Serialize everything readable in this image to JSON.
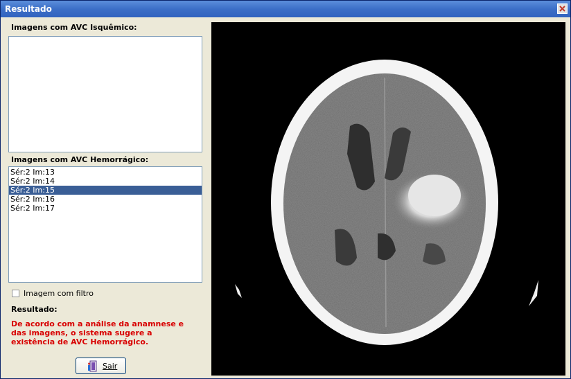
{
  "window": {
    "title": "Resultado"
  },
  "ischemic": {
    "label": "Imagens com AVC Isquêmico:",
    "items": []
  },
  "hemorrhagic": {
    "label": "Imagens com AVC Hemorrágico:",
    "items": [
      "Sér:2 Im:13",
      "Sér:2 Im:14",
      "Sér:2 Im:15",
      "Sér:2 Im:16",
      "Sér:2 Im:17"
    ],
    "selected_index": 2
  },
  "filter": {
    "label": "Imagem com filtro",
    "checked": false
  },
  "result": {
    "label": "Resultado:",
    "message": "De acordo com a análise da anamnese e das imagens, o sistema sugere a existência de AVC Hemorrágico."
  },
  "exit_button": {
    "label": "Sair"
  },
  "colors": {
    "result_text": "#D80000",
    "selection": "#3A5E96"
  }
}
